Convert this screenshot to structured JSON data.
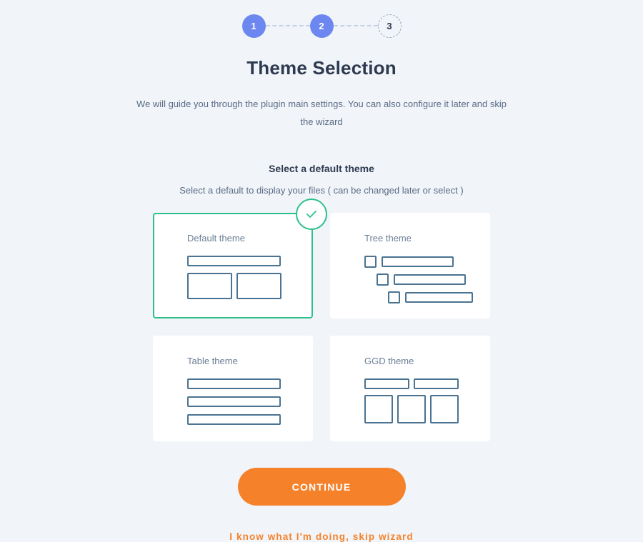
{
  "wizard": {
    "steps": [
      {
        "label": "1",
        "state": "done"
      },
      {
        "label": "2",
        "state": "done"
      },
      {
        "label": "3",
        "state": "pending"
      }
    ]
  },
  "header": {
    "title": "Theme Selection",
    "description": "We will guide you through the plugin main settings. You can also configure it later and skip the wizard"
  },
  "section": {
    "heading": "Select a default theme",
    "subheading": "Select a default to display your files ( can be changed later or select )"
  },
  "themes": [
    {
      "label": "Default theme",
      "selected": true
    },
    {
      "label": "Tree theme",
      "selected": false
    },
    {
      "label": "Table theme",
      "selected": false
    },
    {
      "label": "GGD theme",
      "selected": false
    }
  ],
  "actions": {
    "continue_label": "CONTINUE",
    "skip_label": "I know what I'm doing, skip wizard"
  },
  "colors": {
    "background": "#f1f5fa",
    "step_active": "#6d87f0",
    "selected_border": "#2ec08a",
    "accent_orange": "#f5822a",
    "skeleton_stroke": "#4a7391",
    "heading": "#2e3a50",
    "body_text": "#5a6b84"
  },
  "icons": {
    "check": "check-icon"
  }
}
